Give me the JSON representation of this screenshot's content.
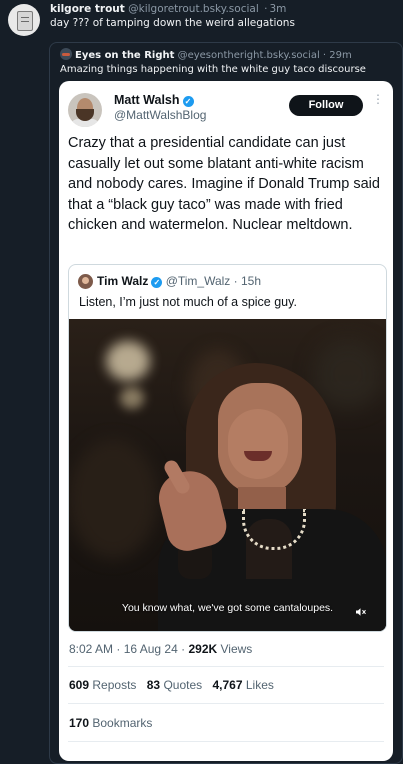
{
  "post": {
    "author_name": "kilgore trout",
    "author_handle": "@kilgoretrout.bsky.social",
    "separator": "·",
    "time": "3m",
    "text": "day ??? of tamping down the weird allegations"
  },
  "quote": {
    "author_name": "Eyes on the Right",
    "author_handle": "@eyesontheright.bsky.social",
    "separator": "·",
    "time": "29m",
    "text": "Amazing things happening with the white guy taco discourse"
  },
  "tweet": {
    "author_name": "Matt Walsh",
    "author_handle": "@MattWalshBlog",
    "verified_mark": "✓",
    "follow_label": "Follow",
    "more_label": "⋮",
    "text": "Crazy that a presidential candidate can just casually let out some blatant anti-white racism and nobody cares. Imagine if Donald Trump said that a “black guy taco” was made with fried chicken and watermelon. Nuclear meltdown.",
    "inner": {
      "author_name": "Tim Walz",
      "author_handle": "@Tim_Walz",
      "separator": "·",
      "time": "15h",
      "verified_mark": "✓",
      "text": "Listen, I’m just not much of a spice guy.",
      "video_caption": "You know what, we've got some cantaloupes.",
      "mute_icon": "speaker-muted-icon"
    },
    "meta": {
      "time": "8:02 AM",
      "separator": "·",
      "date": "16 Aug 24",
      "separator2": "·",
      "views_count": "292K",
      "views_label": "Views"
    },
    "stats": {
      "reposts_count": "609",
      "reposts_label": "Reposts",
      "quotes_count": "83",
      "quotes_label": "Quotes",
      "likes_count": "4,767",
      "likes_label": "Likes"
    },
    "bookmarks": {
      "count": "170",
      "label": "Bookmarks"
    }
  },
  "colors": {
    "background": "#161e27",
    "muted_text": "#8b98a5",
    "verified": "#1d9bf0",
    "tweet_bg": "#ffffff"
  }
}
